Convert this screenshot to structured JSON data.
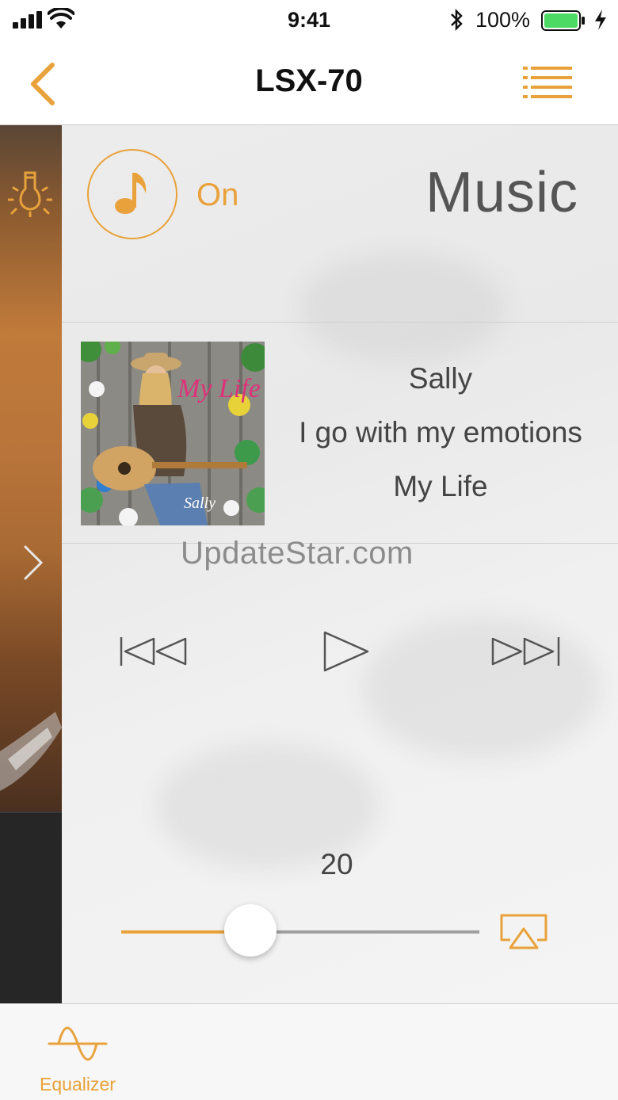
{
  "status_bar": {
    "time": "9:41",
    "battery_percent": "100%",
    "battery_color": "#4cd964",
    "icons": [
      "signal-icon",
      "wifi-icon",
      "bluetooth-icon",
      "battery-icon",
      "charging-icon"
    ]
  },
  "nav": {
    "title": "LSX-70",
    "back_icon": "chevron-left-icon",
    "menu_icon": "list-icon"
  },
  "side": {
    "light_icon": "bulb-icon",
    "expand_icon": "chevron-right-icon"
  },
  "source": {
    "icon": "music-note-icon",
    "state": "On",
    "name": "Music"
  },
  "track": {
    "artist": "Sally",
    "song": "I go with my emotions",
    "album": "My Life",
    "art_title": "My Life",
    "art_artist": "Sally"
  },
  "watermark": "UpdateStar.com",
  "transport": {
    "prev_icon": "skip-back-icon",
    "play_icon": "play-icon",
    "next_icon": "skip-forward-icon"
  },
  "volume": {
    "value": "20",
    "level": 0.36,
    "airplay_icon": "airplay-icon"
  },
  "tab_bar": {
    "equalizer_label": "Equalizer",
    "equalizer_icon": "sine-wave-icon"
  },
  "colors": {
    "accent": "#e9a23b",
    "text": "#444444"
  }
}
